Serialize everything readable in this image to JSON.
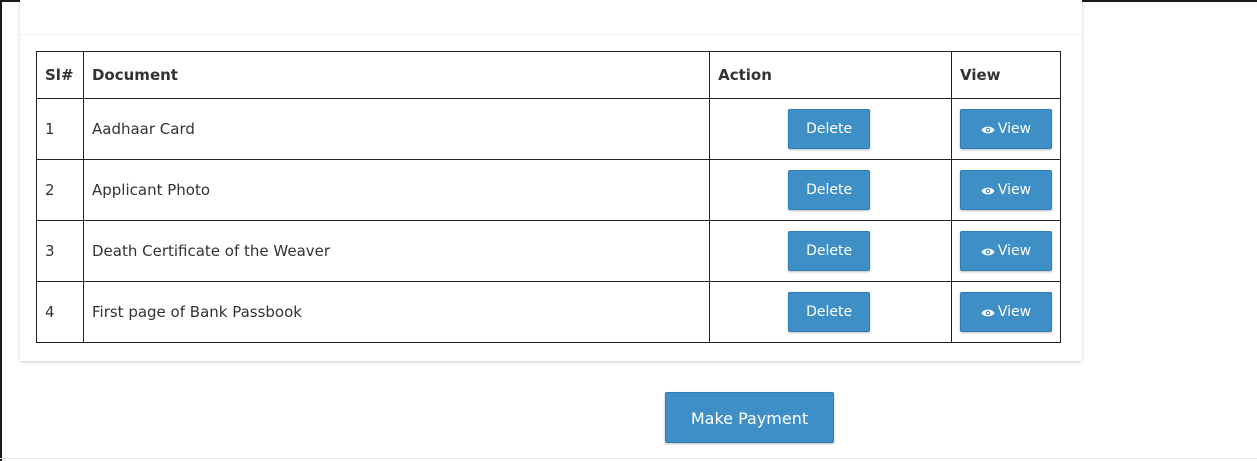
{
  "table": {
    "headers": {
      "sl": "Sl#",
      "document": "Document",
      "action": "Action",
      "view": "View"
    },
    "rows": [
      {
        "sl": "1",
        "document": "Aadhaar Card",
        "action_label": "Delete",
        "view_label": "View"
      },
      {
        "sl": "2",
        "document": "Applicant Photo",
        "action_label": "Delete",
        "view_label": "View"
      },
      {
        "sl": "3",
        "document": "Death Certificate of the Weaver",
        "action_label": "Delete",
        "view_label": "View"
      },
      {
        "sl": "4",
        "document": "First page of Bank Passbook",
        "action_label": "Delete",
        "view_label": "View"
      }
    ]
  },
  "actions": {
    "make_payment_label": "Make Payment"
  },
  "colors": {
    "button_primary": "#3d8fc6",
    "button_text": "#ffffff",
    "table_border": "#222222"
  },
  "icons": {
    "view_button_icon": "eye-icon"
  }
}
